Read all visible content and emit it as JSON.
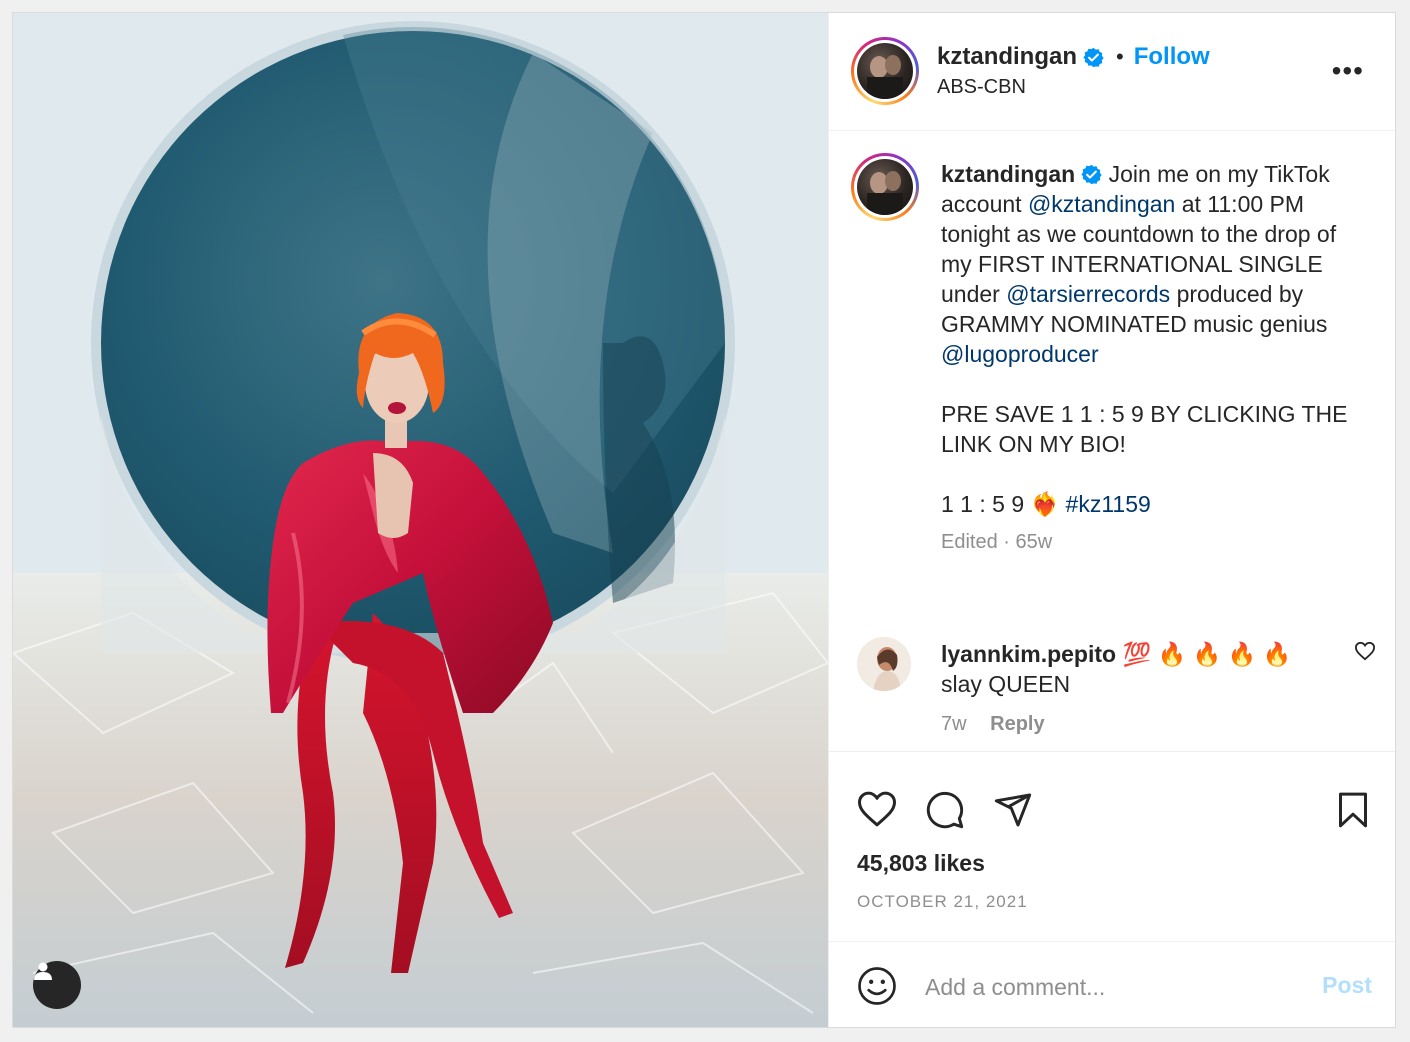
{
  "post": {
    "author": {
      "username": "kztandingan",
      "location": "ABS-CBN",
      "follow_label": "Follow",
      "separator": "•",
      "more_label": "•••"
    },
    "caption": {
      "username": "kztandingan",
      "text_1": "Join me on my TikTok account",
      "mention_1": "@kztandingan",
      "text_2": "at 11:00 PM tonight as we countdown to the drop of my FIRST INTERNATIONAL SINGLE under",
      "mention_2": "@tarsierrecords",
      "text_3": "produced by GRAMMY NOMINATED music genius",
      "mention_3": "@lugoproducer",
      "line_presave": "PRE SAVE 1 1 : 5 9 BY CLICKING THE LINK ON MY BIO!",
      "line_time": "1 1 : 5 9",
      "emoji_heart": "❤️‍🔥",
      "hashtag": "#kz1159",
      "edited": "Edited · 65w"
    },
    "comments": [
      {
        "username": "lyannkim.pepito",
        "emojis": "💯 🔥 🔥 🔥 🔥",
        "text": "slay QUEEN",
        "age": "7w",
        "reply_label": "Reply"
      }
    ],
    "likes": "45,803 likes",
    "date": "OCTOBER 21, 2021",
    "add_comment_placeholder": "Add a comment...",
    "post_label": "Post"
  },
  "colors": {
    "link_blue": "#0095f6",
    "mention_navy": "#00376b",
    "muted_grey": "#8e8e8e",
    "post_disabled": "#b2dffc",
    "verified_blue": "#0095f6"
  },
  "icons": [
    "user-tag-icon",
    "verified-icon",
    "more-options-icon",
    "heart-icon",
    "comment-icon",
    "share-icon",
    "bookmark-icon",
    "emoji-icon",
    "small-heart-icon"
  ]
}
